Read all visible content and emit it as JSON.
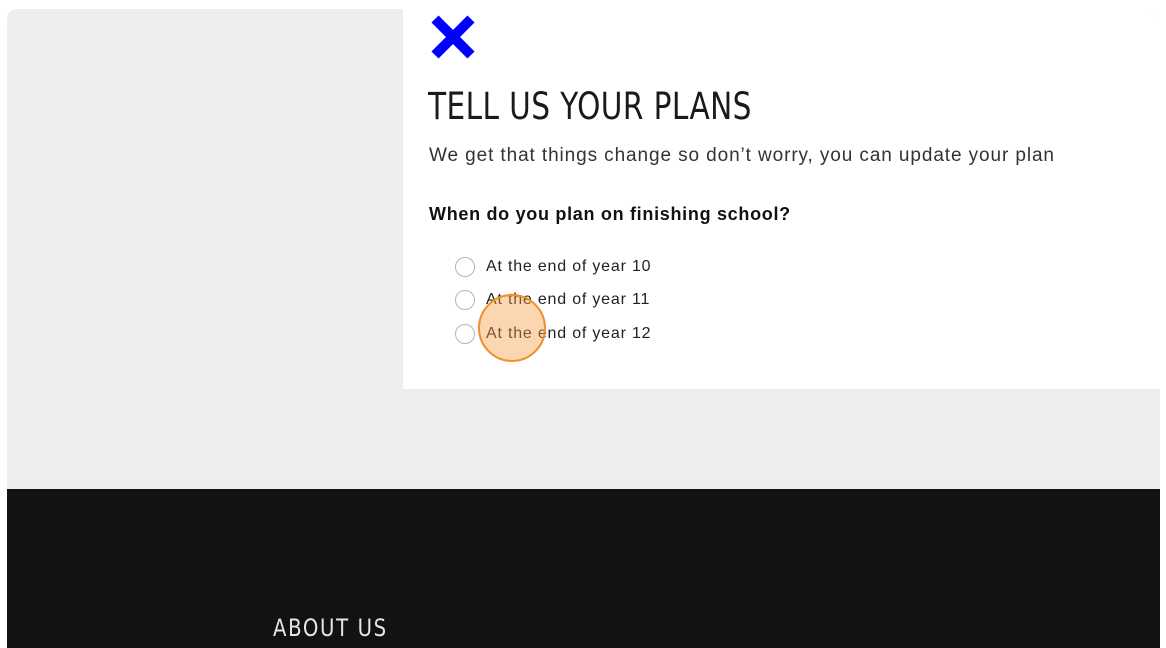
{
  "modal": {
    "close_icon": "close-x-icon",
    "close_color": "#0000ff",
    "title": "TELL US YOUR PLANS",
    "subtitle": "We get that things change so don’t worry, you can update your plan",
    "question": "When do you plan on finishing school?",
    "options": [
      {
        "label": "At the end of year 10",
        "selected": false
      },
      {
        "label": "At the end of year 11",
        "selected": false
      },
      {
        "label": "At the end of year 12",
        "selected": false
      }
    ]
  },
  "footer": {
    "about_label": "ABOUT US",
    "background": "#121212"
  },
  "click_marker_color": "#ef8f2a"
}
